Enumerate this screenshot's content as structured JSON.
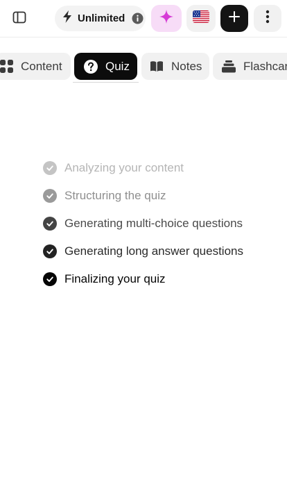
{
  "header": {
    "plan_label": "Unlimited",
    "icons": {
      "sidebar": "sidebar-panel-icon",
      "plan": "lightning-bolt-icon",
      "info": "info-icon",
      "sparkle": "sparkle-icon",
      "language": "us-flag-icon",
      "add": "plus-icon",
      "more": "vertical-dots-icon"
    },
    "colors": {
      "sparkle_bg": "#f7dcf7",
      "sparkle": "#d63bd6",
      "add_bg": "#141414"
    }
  },
  "tabs": [
    {
      "label": "Content",
      "icon": "grid-icon",
      "active": false
    },
    {
      "label": "Quiz",
      "icon": "question-circle-icon",
      "active": true
    },
    {
      "label": "Notes",
      "icon": "open-book-icon",
      "active": false
    },
    {
      "label": "Flashcards",
      "icon": "card-stack-icon",
      "active": false
    }
  ],
  "progress": {
    "steps": [
      {
        "label": "Analyzing your content"
      },
      {
        "label": "Structuring the quiz"
      },
      {
        "label": "Generating multi-choice questions"
      },
      {
        "label": "Generating long answer questions"
      },
      {
        "label": "Finalizing your quiz"
      }
    ]
  }
}
